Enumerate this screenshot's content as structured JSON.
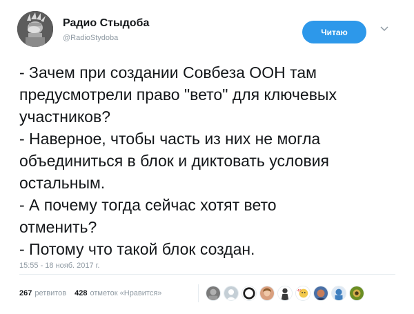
{
  "author": {
    "name": "Радио Стыдоба",
    "handle": "@RadioStydoba",
    "avatar_icon": "statue-of-liberty-facepalm-avatar"
  },
  "follow_button": {
    "label": "Читаю",
    "color": "#2d98ea"
  },
  "menu_icon": "chevron-down-icon",
  "tweet": {
    "lines": [
      "- Зачем при создании Совбеза ООН там",
      "предусмотрели право \"вето\" для ключевых",
      "участников?",
      "- Наверное, чтобы часть из них не могла",
      "объединиться в блок и диктовать условия",
      "остальным.",
      "- А почему тогда сейчас хотят вето",
      "отменить?",
      "- Потому что такой блок создан."
    ],
    "timestamp": "15:55 - 18 нояб. 2017 г."
  },
  "stats": {
    "retweets_count": "267",
    "retweets_label": "ретвитов",
    "likes_count": "428",
    "likes_label": "отметок «Нравится»"
  },
  "likers": [
    {
      "icon": "avatar-gray-photo",
      "color": "#7a7a7a"
    },
    {
      "icon": "avatar-default-egg",
      "color": "#c5cfd6"
    },
    {
      "icon": "avatar-black-circle",
      "color": "#1d1d1d"
    },
    {
      "icon": "avatar-face-photo",
      "color": "#d9a07f"
    },
    {
      "icon": "avatar-dark-figure",
      "color": "#3b3b3b"
    },
    {
      "icon": "avatar-yellow-cartoon",
      "color": "#f2c94c"
    },
    {
      "icon": "avatar-blue-photo",
      "color": "#4a6fa5"
    },
    {
      "icon": "avatar-blue-cartoon",
      "color": "#3f7fbf"
    },
    {
      "icon": "avatar-green-photo",
      "color": "#6b8e23"
    }
  ]
}
